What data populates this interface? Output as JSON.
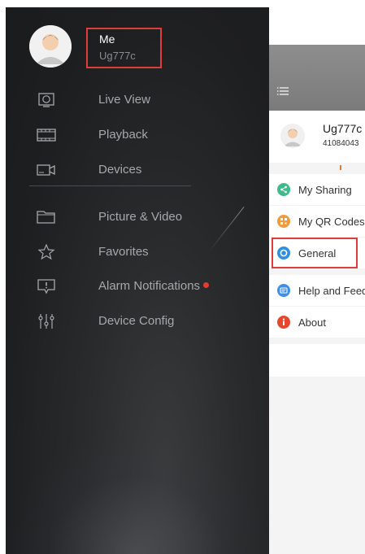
{
  "drawer": {
    "profile": {
      "name": "Me",
      "user_id": "Ug777c"
    },
    "items": [
      {
        "label": "Live View",
        "icon": "live-view-icon"
      },
      {
        "label": "Playback",
        "icon": "film-icon"
      },
      {
        "label": "Devices",
        "icon": "camera-icon"
      },
      {
        "label": "Picture & Video",
        "icon": "folder-icon"
      },
      {
        "label": "Favorites",
        "icon": "star-icon"
      },
      {
        "label": "Alarm Notifications",
        "icon": "alert-icon",
        "badge": true
      },
      {
        "label": "Device Config",
        "icon": "sliders-icon"
      }
    ]
  },
  "panel": {
    "user_name": "Ug777c",
    "user_number": "41084043",
    "menu": [
      {
        "label": "My Sharing",
        "icon": "share-icon",
        "color": "#3dbb8a"
      },
      {
        "label": "My QR Codes",
        "icon": "qr-icon",
        "color": "#f39a3c"
      },
      {
        "label": "General",
        "icon": "general-icon",
        "color": "#2f8fe0"
      },
      {
        "label": "Help and Feedback",
        "icon": "help-icon",
        "color": "#3f8fe6"
      },
      {
        "label": "About",
        "icon": "info-icon",
        "color": "#e8472f"
      }
    ]
  },
  "colors": {
    "highlight": "#e23b3b",
    "badge": "#e83b2f"
  }
}
